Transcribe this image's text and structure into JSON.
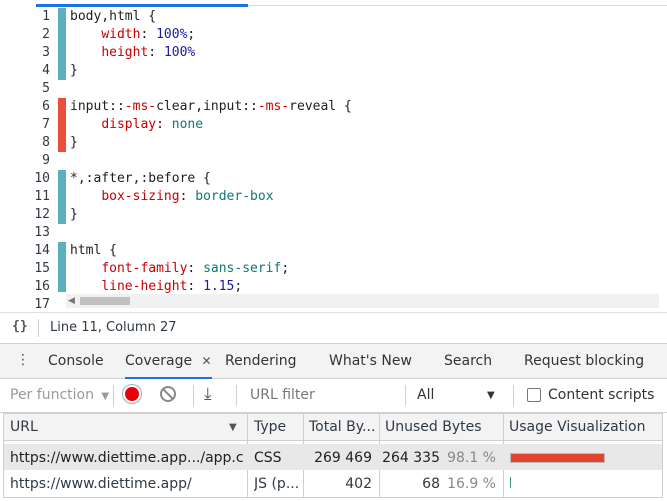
{
  "editor": {
    "lines": [
      {
        "n": "1",
        "segments": [
          {
            "t": "body,html {",
            "c": "sel"
          }
        ]
      },
      {
        "n": "2",
        "segments": [
          {
            "t": "    ",
            "c": ""
          },
          {
            "t": "width",
            "c": "prop"
          },
          {
            "t": ": ",
            "c": ""
          },
          {
            "t": "100%",
            "c": "val"
          },
          {
            "t": ";",
            "c": ""
          }
        ]
      },
      {
        "n": "3",
        "segments": [
          {
            "t": "    ",
            "c": ""
          },
          {
            "t": "height",
            "c": "prop"
          },
          {
            "t": ": ",
            "c": ""
          },
          {
            "t": "100%",
            "c": "val"
          }
        ]
      },
      {
        "n": "4",
        "segments": [
          {
            "t": "}",
            "c": ""
          }
        ]
      },
      {
        "n": "5",
        "segments": []
      },
      {
        "n": "6",
        "segments": [
          {
            "t": "input::",
            "c": "sel"
          },
          {
            "t": "-ms-",
            "c": "prop"
          },
          {
            "t": "clear,input::",
            "c": "sel"
          },
          {
            "t": "-ms-",
            "c": "prop"
          },
          {
            "t": "reveal {",
            "c": "sel"
          }
        ]
      },
      {
        "n": "7",
        "segments": [
          {
            "t": "    ",
            "c": ""
          },
          {
            "t": "display",
            "c": "prop"
          },
          {
            "t": ": ",
            "c": ""
          },
          {
            "t": "none",
            "c": "kw"
          }
        ]
      },
      {
        "n": "8",
        "segments": [
          {
            "t": "}",
            "c": ""
          }
        ]
      },
      {
        "n": "9",
        "segments": []
      },
      {
        "n": "10",
        "segments": [
          {
            "t": "*,:after,:before {",
            "c": "sel"
          }
        ]
      },
      {
        "n": "11",
        "segments": [
          {
            "t": "    ",
            "c": ""
          },
          {
            "t": "box-sizing",
            "c": "prop"
          },
          {
            "t": ": ",
            "c": ""
          },
          {
            "t": "border-box",
            "c": "kw"
          }
        ]
      },
      {
        "n": "12",
        "segments": [
          {
            "t": "}",
            "c": ""
          }
        ]
      },
      {
        "n": "13",
        "segments": []
      },
      {
        "n": "14",
        "segments": [
          {
            "t": "html {",
            "c": "sel"
          }
        ]
      },
      {
        "n": "15",
        "segments": [
          {
            "t": "    ",
            "c": ""
          },
          {
            "t": "font-family",
            "c": "prop"
          },
          {
            "t": ": ",
            "c": ""
          },
          {
            "t": "sans-serif",
            "c": "kw"
          },
          {
            "t": ";",
            "c": ""
          }
        ]
      },
      {
        "n": "16",
        "segments": [
          {
            "t": "    ",
            "c": ""
          },
          {
            "t": "line-height",
            "c": "prop"
          },
          {
            "t": ": ",
            "c": ""
          },
          {
            "t": "1.15",
            "c": "val"
          },
          {
            "t": ";",
            "c": ""
          }
        ]
      },
      {
        "n": "17",
        "segments": []
      }
    ],
    "coverage_bars": [
      {
        "from_line": 1,
        "to_line": 4,
        "status": "used",
        "color": "#5bb0bd"
      },
      {
        "from_line": 6,
        "to_line": 8,
        "status": "unused",
        "color": "#e8503a"
      },
      {
        "from_line": 10,
        "to_line": 12,
        "status": "used",
        "color": "#5bb0bd"
      },
      {
        "from_line": 14,
        "to_line": 17,
        "status": "used",
        "color": "#5bb0bd"
      }
    ]
  },
  "status_bar": {
    "braces_icon": "{}",
    "position": "Line 11, Column 27"
  },
  "drawer_tabs": {
    "items": [
      {
        "label": "Console",
        "active": false
      },
      {
        "label": "Coverage",
        "active": true,
        "closable": true
      },
      {
        "label": "Rendering",
        "active": false
      },
      {
        "label": "What's New",
        "active": false
      },
      {
        "label": "Search",
        "active": false
      },
      {
        "label": "Request blocking",
        "active": false
      }
    ],
    "close_glyph": "✕"
  },
  "toolbar": {
    "granularity": "Per function",
    "url_filter_placeholder": "URL filter",
    "type_select": "All",
    "content_scripts_label": "Content scripts"
  },
  "table": {
    "headers": [
      "URL",
      "Type",
      "Total By...",
      "Unused Bytes",
      "Usage Visualization"
    ],
    "sort_glyph": "▼",
    "rows": [
      {
        "url": "https://www.diettime.app.../app.css",
        "type": "CSS",
        "total": "269 469",
        "unused": "264 335",
        "pct": "98.1 %",
        "usage_unused_fraction": 0.981,
        "selected": true
      },
      {
        "url": "https://www.diettime.app/",
        "type": "JS (p...",
        "total": "402",
        "unused": "68",
        "pct": "16.9 %",
        "usage_unused_fraction": 0.169,
        "selected": false
      }
    ]
  },
  "colors": {
    "accent": "#1a73e8",
    "record": "#e8000b",
    "unused": "#e3442f",
    "used": "#5bb0bd"
  }
}
